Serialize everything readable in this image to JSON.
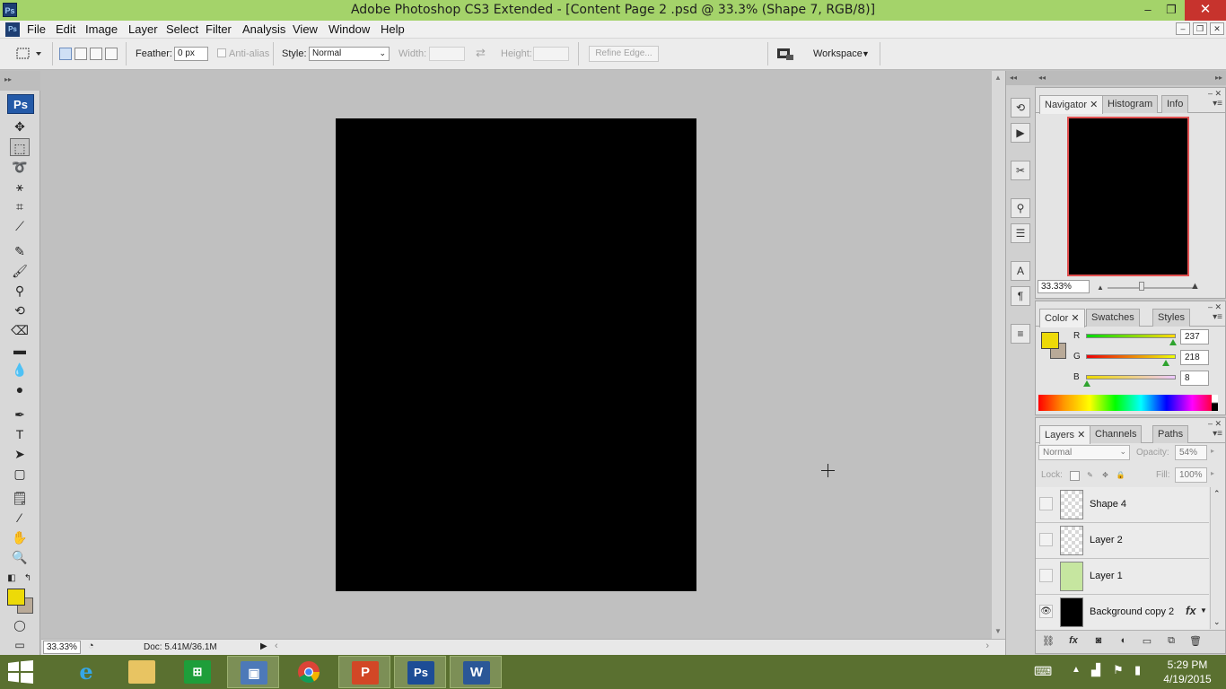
{
  "window": {
    "title": "Adobe Photoshop CS3 Extended - [Content Page 2 .psd @ 33.3% (Shape 7, RGB/8)]",
    "app_badge": "Ps",
    "minimize": "–",
    "maximize": "❐",
    "close": "✕"
  },
  "menubar": {
    "items": [
      "File",
      "Edit",
      "Image",
      "Layer",
      "Select",
      "Filter",
      "Analysis",
      "View",
      "Window",
      "Help"
    ]
  },
  "options": {
    "feather_label": "Feather:",
    "feather_value": "0 px",
    "antialias_label": "Anti-alias",
    "style_label": "Style:",
    "style_value": "Normal",
    "width_label": "Width:",
    "height_label": "Height:",
    "refine_edge": "Refine Edge...",
    "workspace": "Workspace"
  },
  "toolbox": {
    "logo": "Ps",
    "fg_color": "#edda08",
    "bg_color": "#b9aa98"
  },
  "status": {
    "zoom": "33.33%",
    "doc_info": "Doc: 5.41M/36.1M"
  },
  "navigator": {
    "tabs": [
      "Navigator",
      "Histogram",
      "Info"
    ],
    "zoom": "33.33%"
  },
  "color_panel": {
    "tabs": [
      "Color",
      "Swatches",
      "Styles"
    ],
    "channels": [
      {
        "label": "R",
        "value": "237"
      },
      {
        "label": "G",
        "value": "218"
      },
      {
        "label": "B",
        "value": "8"
      }
    ]
  },
  "layers_panel": {
    "tabs": [
      "Layers",
      "Channels",
      "Paths"
    ],
    "blend_mode": "Normal",
    "opacity_label": "Opacity:",
    "opacity": "54%",
    "lock_label": "Lock:",
    "fill_label": "Fill:",
    "fill": "100%",
    "layers": [
      {
        "name": "Shape 4",
        "visible": false
      },
      {
        "name": "Layer 2",
        "visible": false
      },
      {
        "name": "Layer 1",
        "visible": false
      },
      {
        "name": "Background copy 2",
        "visible": true,
        "fx": "fx"
      }
    ]
  },
  "taskbar": {
    "apps": [
      "Internet Explorer",
      "File Explorer",
      "Store",
      "Remote Desktop",
      "Chrome",
      "PowerPoint",
      "Photoshop",
      "Word"
    ],
    "time": "5:29 PM",
    "date": "4/19/2015"
  }
}
